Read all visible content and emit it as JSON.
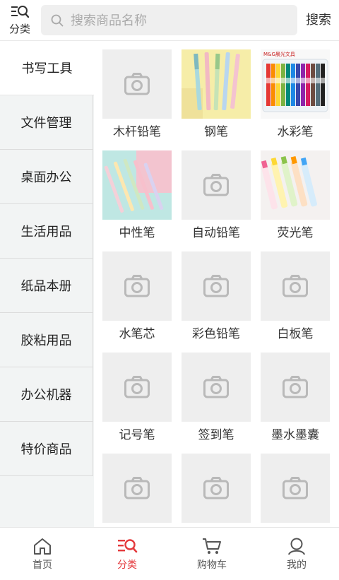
{
  "header": {
    "category_label": "分类",
    "search_placeholder": "搜索商品名称",
    "search_button": "搜索"
  },
  "sidebar": {
    "items": [
      {
        "label": "书写工具",
        "active": true
      },
      {
        "label": "文件管理"
      },
      {
        "label": "桌面办公"
      },
      {
        "label": "生活用品"
      },
      {
        "label": "纸品本册"
      },
      {
        "label": "胶粘用品"
      },
      {
        "label": "办公机器"
      },
      {
        "label": "特价商品"
      }
    ]
  },
  "grid": {
    "items": [
      {
        "label": "木杆铅笔",
        "image": "placeholder"
      },
      {
        "label": "钢笔",
        "image": "pens-yellow-photo"
      },
      {
        "label": "水彩笔",
        "image": "markers-box-photo",
        "brand_text": "M&G晨光文具"
      },
      {
        "label": "中性笔",
        "image": "gel-pens-photo"
      },
      {
        "label": "自动铅笔",
        "image": "placeholder"
      },
      {
        "label": "荧光笔",
        "image": "highlighters-photo"
      },
      {
        "label": "水笔芯",
        "image": "placeholder"
      },
      {
        "label": "彩色铅笔",
        "image": "placeholder"
      },
      {
        "label": "白板笔",
        "image": "placeholder"
      },
      {
        "label": "记号笔",
        "image": "placeholder"
      },
      {
        "label": "签到笔",
        "image": "placeholder"
      },
      {
        "label": "墨水墨囊",
        "image": "placeholder"
      },
      {
        "label": "",
        "image": "placeholder"
      },
      {
        "label": "",
        "image": "placeholder"
      },
      {
        "label": "",
        "image": "placeholder"
      }
    ]
  },
  "bottom_nav": {
    "items": [
      {
        "label": "首页",
        "icon": "home-icon"
      },
      {
        "label": "分类",
        "icon": "category-icon",
        "active": true
      },
      {
        "label": "购物车",
        "icon": "cart-icon"
      },
      {
        "label": "我的",
        "icon": "user-icon"
      }
    ]
  },
  "colors": {
    "accent": "#e4393c",
    "sidebar_bg": "#f2f4f4",
    "placeholder_bg": "#eeeeee"
  }
}
